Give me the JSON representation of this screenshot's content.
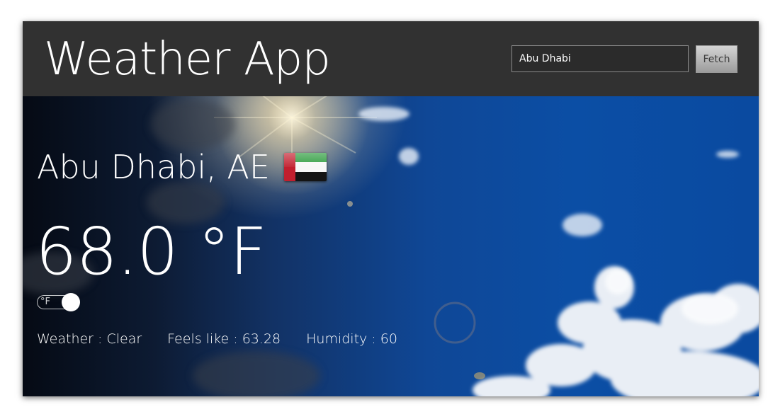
{
  "header": {
    "title": "Weather App",
    "search_value": "Abu Dhabi",
    "fetch_label": "Fetch"
  },
  "weather": {
    "location": "Abu Dhabi, AE",
    "flag": "UAE-flag",
    "temperature": "68.0 °F",
    "unit_toggle_label": "°F",
    "unit_toggle_on": true,
    "condition": "Weather : Clear",
    "feels_like": "Feels like : 63.28",
    "humidity": "Humidity : 60"
  },
  "colors": {
    "header_bg": "#313131",
    "sky": "#0d4a98",
    "text": "#ffffff"
  }
}
